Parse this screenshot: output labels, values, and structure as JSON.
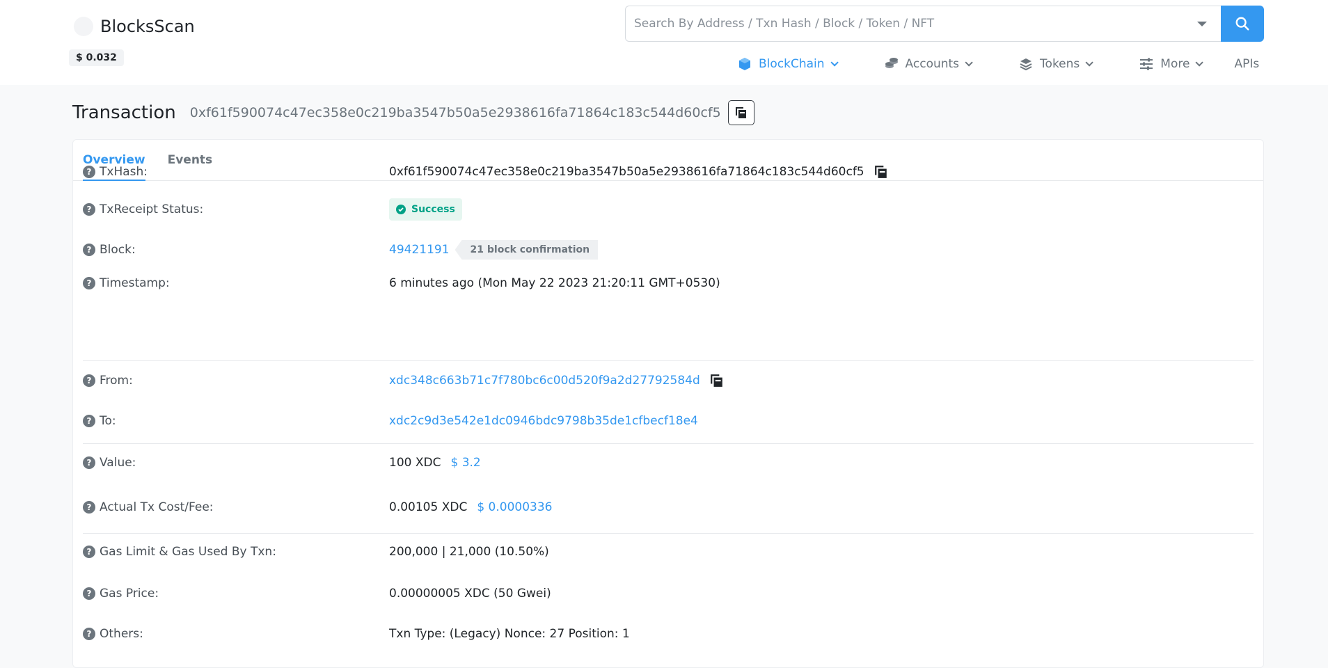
{
  "header": {
    "logo_text": "BlocksScan",
    "price": "$ 0.032",
    "search_placeholder": "Search By Address / Txn Hash / Block / Token / NFT",
    "nav": [
      {
        "label": "BlockChain",
        "icon": "cube-icon"
      },
      {
        "label": "Accounts",
        "icon": "coins-icon"
      },
      {
        "label": "Tokens",
        "icon": "layers-icon"
      },
      {
        "label": "More",
        "icon": "sliders-icon"
      },
      {
        "label": "APIs"
      }
    ]
  },
  "page": {
    "title": "Transaction",
    "hash": "0xf61f590074c47ec358e0c219ba3547b50a5e2938616fa71864c183c544d60cf5"
  },
  "tabs": [
    "Overview",
    "Events"
  ],
  "details": {
    "txhash": {
      "label": "TxHash:",
      "value": "0xf61f590074c47ec358e0c219ba3547b50a5e2938616fa71864c183c544d60cf5"
    },
    "status": {
      "label": "TxReceipt Status:",
      "value": "Success"
    },
    "block": {
      "label": "Block:",
      "value": "49421191",
      "confirmations": "21 block confirmation"
    },
    "timestamp": {
      "label": "Timestamp:",
      "value": "6 minutes ago (Mon May 22 2023 21:20:11 GMT+0530)"
    },
    "from": {
      "label": "From:",
      "value": "xdc348c663b71c7f780bc6c00d520f9a2d27792584d"
    },
    "to": {
      "label": "To:",
      "value": "xdc2c9d3e542e1dc0946bdc9798b35de1cfbecf18e4"
    },
    "value": {
      "label": "Value:",
      "value": "100 XDC",
      "usd": "$ 3.2"
    },
    "fee": {
      "label": "Actual Tx Cost/Fee:",
      "value": "0.00105 XDC",
      "usd": "$ 0.0000336"
    },
    "gas_limit": {
      "label": "Gas Limit & Gas Used By Txn:",
      "value": "200,000 | 21,000 (10.50%)"
    },
    "gas_price": {
      "label": "Gas Price:",
      "value": "0.00000005 XDC (50 Gwei)"
    },
    "others": {
      "label": "Others:",
      "value": "Txn Type: (Legacy) Nonce: 27 Position: 1"
    }
  },
  "colors": {
    "accent": "#3498f0",
    "success": "#00a186"
  }
}
